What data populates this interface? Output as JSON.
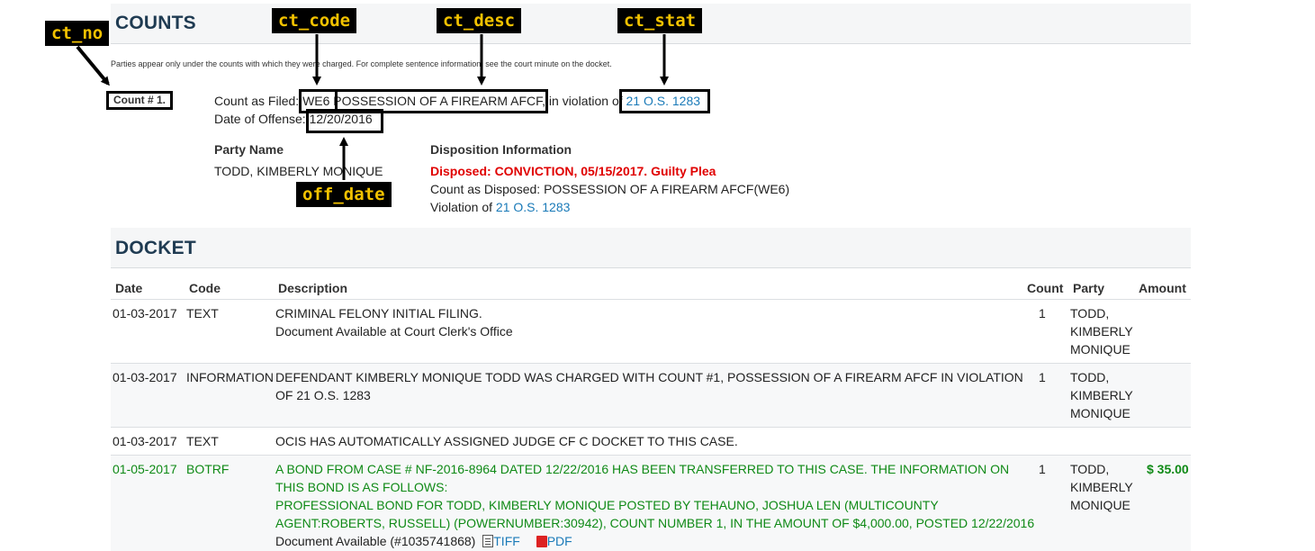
{
  "counts": {
    "section_title": "COUNTS",
    "note": "Parties appear only under the counts with which they were charged. For complete sentence information, see the court minute on the docket.",
    "count_label": "Count # 1.",
    "filed_prefix": "Count as Filed:",
    "code": "WE6",
    "desc": "POSSESSION OF A FIREARM AFCF",
    "violation_prefix": "in violation of",
    "statute": "21 O.S. 1283",
    "offense_prefix": "Date of Offense:",
    "offense_date": "12/20/2016",
    "party_header": "Party Name",
    "party_name": "TODD, KIMBERLY MONIQUE",
    "dispo_header": "Disposition Information",
    "dispo_status": "Disposed: CONVICTION, 05/15/2017. Guilty Plea",
    "dispo_count": "Count as Disposed: POSSESSION OF A FIREARM AFCF(WE6)",
    "dispo_violation_prefix": "Violation of",
    "dispo_statute": "21 O.S. 1283"
  },
  "annotations": {
    "ct_no": "ct_no",
    "ct_code": "ct_code",
    "ct_desc": "ct_desc",
    "ct_stat": "ct_stat",
    "off_date": "off_date"
  },
  "docket": {
    "section_title": "DOCKET",
    "headers": {
      "date": "Date",
      "code": "Code",
      "description": "Description",
      "count": "Count",
      "party": "Party",
      "amount": "Amount"
    },
    "rows": [
      {
        "date": "01-03-2017",
        "code": "TEXT",
        "desc1": "CRIMINAL FELONY INITIAL FILING.",
        "desc2": "Document Available at Court Clerk's Office",
        "count": "1",
        "party1": "TODD,",
        "party2": "KIMBERLY",
        "party3": "MONIQUE"
      },
      {
        "date": "01-03-2017",
        "code": "INFORMATION",
        "desc1": "DEFENDANT KIMBERLY MONIQUE TODD WAS CHARGED WITH COUNT #1, POSSESSION OF A FIREARM AFCF IN VIOLATION",
        "desc2": "OF 21 O.S. 1283",
        "count": "1",
        "party1": "TODD,",
        "party2": "KIMBERLY",
        "party3": "MONIQUE"
      },
      {
        "date": "01-03-2017",
        "code": "TEXT",
        "desc1": "OCIS HAS AUTOMATICALLY ASSIGNED JUDGE CF C DOCKET TO THIS CASE."
      },
      {
        "date": "01-05-2017",
        "code": "BOTRF",
        "desc1": "A BOND FROM CASE # NF-2016-8964 DATED 12/22/2016 HAS BEEN TRANSFERRED TO THIS CASE. THE INFORMATION ON",
        "desc2": "THIS BOND IS AS FOLLOWS:",
        "desc3": "PROFESSIONAL BOND FOR TODD, KIMBERLY MONIQUE POSTED BY TEHAUNO, JOSHUA LEN (MULTICOUNTY",
        "desc4": "AGENT:ROBERTS, RUSSELL) (POWERNUMBER:30942), COUNT NUMBER 1, IN THE AMOUNT OF $4,000.00, POSTED 12/22/2016",
        "doc_text": "Document Available (#1035741868)",
        "tiff": "TIFF",
        "pdf": "PDF",
        "count": "1",
        "party1": "TODD,",
        "party2": "KIMBERLY",
        "party3": "MONIQUE",
        "amount": "$ 35.00"
      }
    ]
  }
}
